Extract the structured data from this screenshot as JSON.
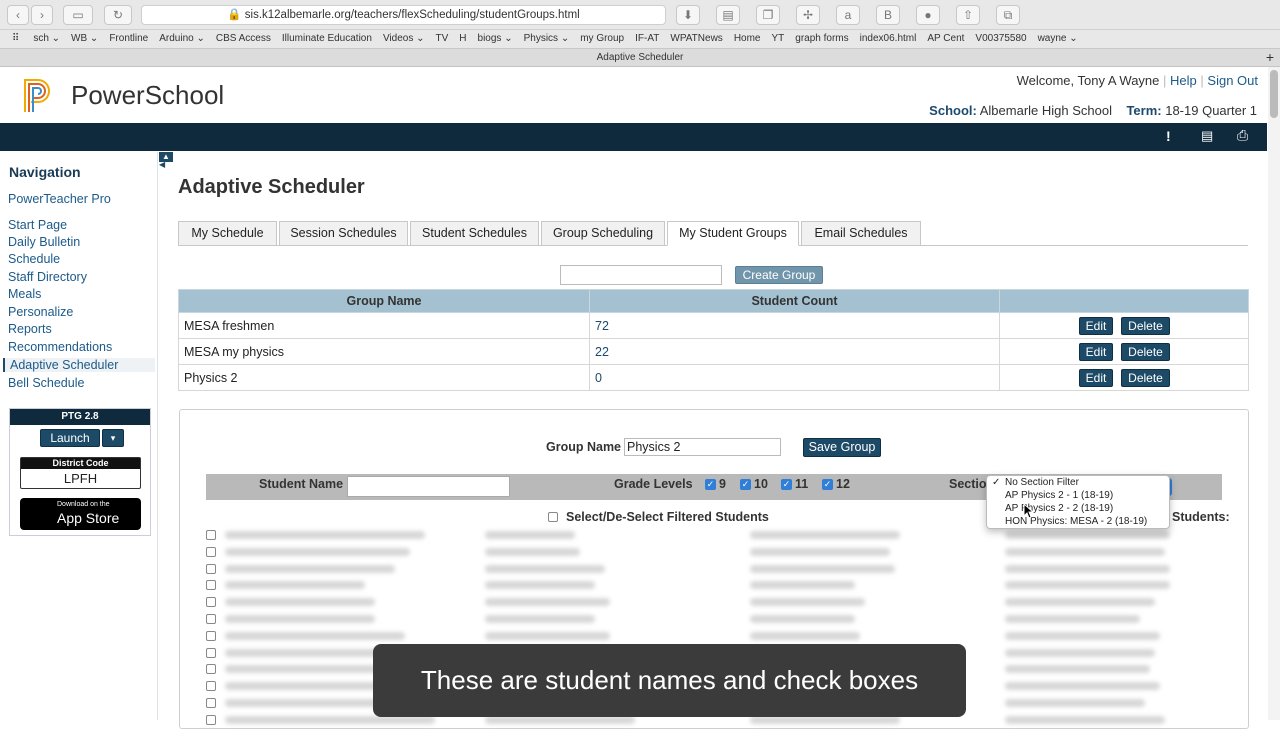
{
  "browser": {
    "url": "sis.k12albemarle.org/teachers/flexScheduling/studentGroups.html",
    "tab_title": "Adaptive Scheduler",
    "bookmarks": [
      "sch ⌄",
      "WB ⌄",
      "Frontline",
      "Arduino ⌄",
      "CBS Access",
      "Illuminate Education",
      "Videos ⌄",
      "TV",
      "H",
      "biogs ⌄",
      "Physics ⌄",
      "my Group",
      "IF-AT",
      "WPATNews",
      "Home",
      "YT",
      "graph forms",
      "index06.html",
      "AP Cent",
      "V00375580",
      "wayne ⌄"
    ]
  },
  "header": {
    "brand": "PowerSchool",
    "welcome": "Welcome, Tony A Wayne",
    "help": "Help",
    "signout": "Sign Out",
    "school_label": "School:",
    "school": "Albemarle High School",
    "term_label": "Term:",
    "term": "18-19 Quarter 1"
  },
  "nav": {
    "title": "Navigation",
    "items": [
      "PowerTeacher Pro",
      "Start Page",
      "Daily Bulletin",
      "Schedule",
      "Staff Directory",
      "Meals",
      "Personalize",
      "Reports",
      "Recommendations",
      "Adaptive Scheduler",
      "Bell Schedule"
    ],
    "ptg": "PTG 2.8",
    "launch": "Launch",
    "district_code_label": "District Code",
    "district_code": "LPFH",
    "appstore_small": "Download on the",
    "appstore_big": "App Store"
  },
  "page": {
    "title": "Adaptive Scheduler",
    "tabs": [
      "My Schedule",
      "Session Schedules",
      "Student Schedules",
      "Group Scheduling",
      "My Student Groups",
      "Email Schedules"
    ],
    "create_group": "Create Group",
    "columns": [
      "Group Name",
      "Student Count",
      ""
    ],
    "groups": [
      {
        "name": "MESA freshmen",
        "count": "72"
      },
      {
        "name": "MESA my physics",
        "count": "22"
      },
      {
        "name": "Physics 2",
        "count": "0"
      }
    ],
    "edit": "Edit",
    "delete": "Delete"
  },
  "editor": {
    "group_name_label": "Group Name",
    "group_name_value": "Physics 2",
    "save_group": "Save Group",
    "student_name_label": "Student Name",
    "grade_levels_label": "Grade Levels",
    "grades": [
      "9",
      "10",
      "11",
      "12"
    ],
    "section_label": "Sectio",
    "select_all": "Select/De-Select Filtered Students",
    "students_label": "Students:",
    "section_options": [
      "No Section Filter",
      "AP Physics 2 - 1 (18-19)",
      "AP Physics 2 - 2 (18-19)",
      "HON Physics: MESA - 2 (18-19)"
    ],
    "selected_option": "✓"
  },
  "caption": "These are student names and check boxes"
}
